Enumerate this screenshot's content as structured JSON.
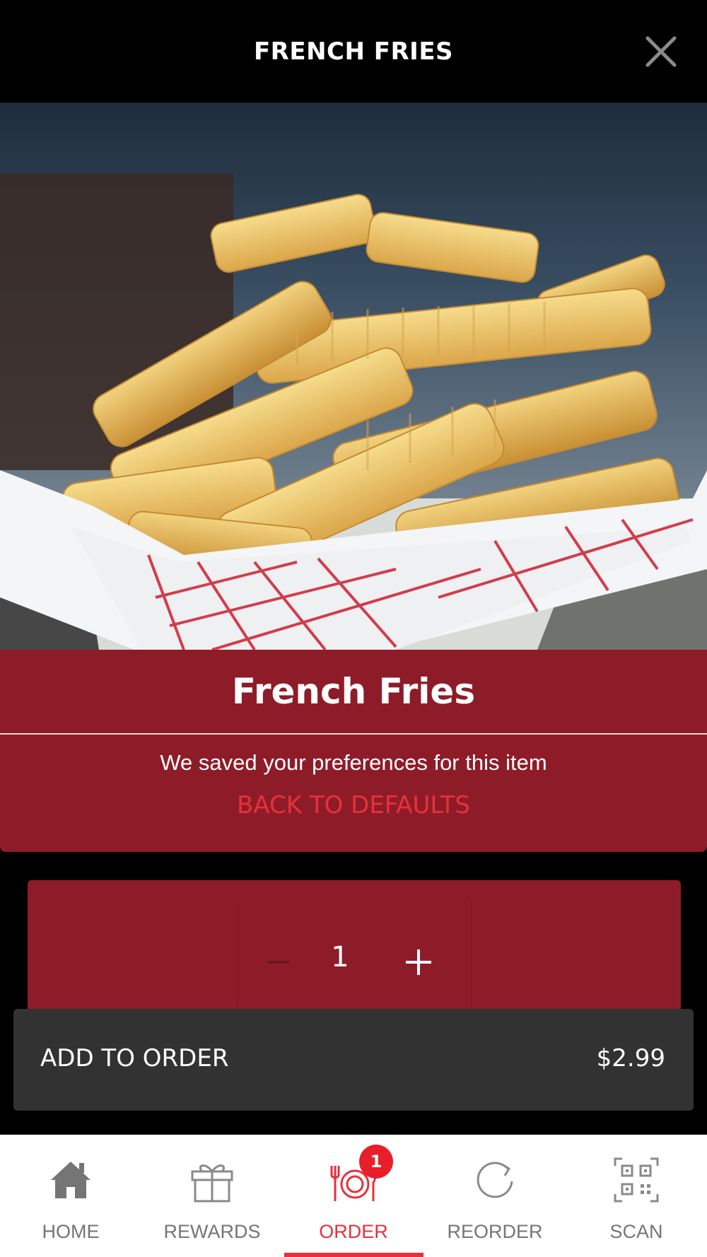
{
  "header": {
    "title": "FRENCH FRIES"
  },
  "item": {
    "name": "French Fries",
    "saved_message": "We saved your preferences for this item",
    "defaults_link": "BACK TO DEFAULTS"
  },
  "quantity": {
    "value": "1"
  },
  "add_to_order": {
    "label": "ADD TO ORDER",
    "price": "$2.99"
  },
  "tabs": [
    {
      "label": "HOME",
      "icon": "home-icon"
    },
    {
      "label": "REWARDS",
      "icon": "gift-icon"
    },
    {
      "label": "ORDER",
      "icon": "plate-cutlery-icon",
      "active": true,
      "badge": "1"
    },
    {
      "label": "REORDER",
      "icon": "refresh-icon"
    },
    {
      "label": "SCAN",
      "icon": "qr-code-icon"
    }
  ],
  "colors": {
    "accent_red": "#e8303b",
    "panel_red": "#8e1c28",
    "bar_dark": "#323232",
    "tab_gray": "#757575"
  }
}
